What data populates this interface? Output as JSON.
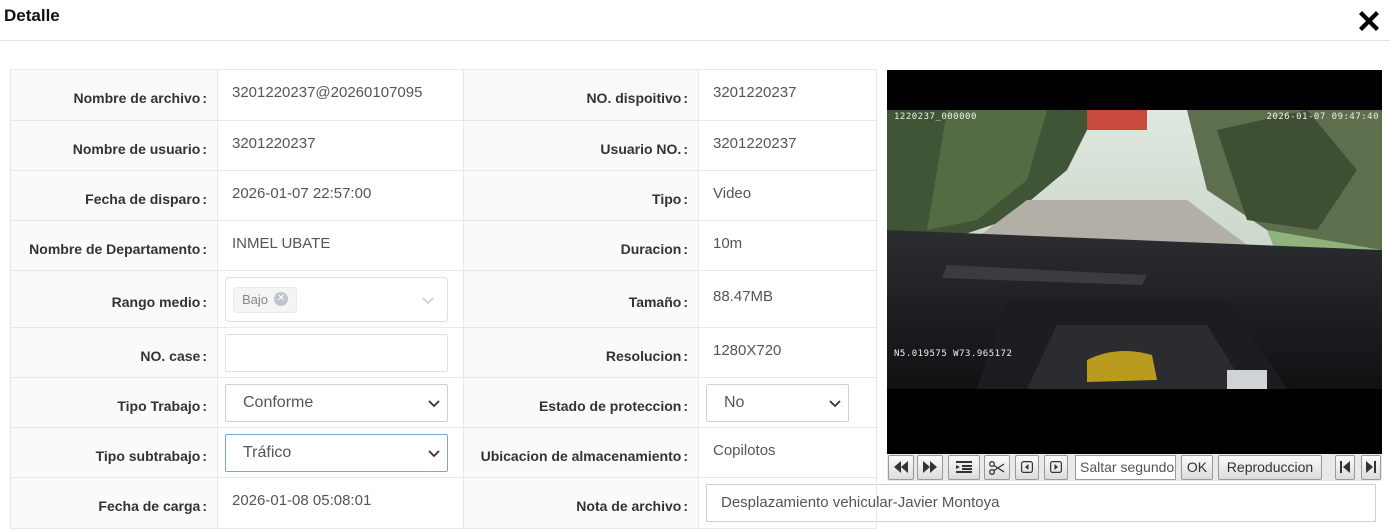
{
  "dialog": {
    "title": "Detalle",
    "close_icon": "close-x-icon"
  },
  "left": {
    "file_name_label": "Nombre de archivo",
    "file_name_value": "3201220237@20260107095",
    "user_name_label": "Nombre de usuario",
    "user_name_value": "3201220237",
    "trigger_date_label": "Fecha de disparo",
    "trigger_date_value": "2026-01-07 22:57:00",
    "department_label": "Nombre de Departamento",
    "department_value": "INMEL UBATE",
    "range_label": "Rango medio",
    "range_tag": "Bajo",
    "case_label": "NO. case",
    "case_value": "",
    "work_type_label": "Tipo Trabajo",
    "work_type_value": "Conforme",
    "subwork_type_label": "Tipo subtrabajo",
    "subwork_type_value": "Tráfico",
    "upload_date_label": "Fecha de carga",
    "upload_date_value": "2026-01-08 05:08:01"
  },
  "right": {
    "device_label": "NO. dispoitivo",
    "device_value": "3201220237",
    "user_no_label": "Usuario NO.",
    "user_no_value": "3201220237",
    "type_label": "Tipo",
    "type_value": "Video",
    "duration_label": "Duracion",
    "duration_value": "10m",
    "size_label": "Tamaño",
    "size_value": "88.47MB",
    "resolution_label": "Resolucion",
    "resolution_value": "1280X720",
    "protection_label": "Estado de proteccion",
    "protection_value": "No",
    "storage_label": "Ubicacion de almacenamiento",
    "storage_value": "Copilotos",
    "note_label": "Nota de archivo",
    "note_value": "Desplazamiento vehicular-Javier Montoya"
  },
  "video": {
    "osd_top_left": "1220237_000000",
    "osd_top_right": "2026-01-07 09:47:40",
    "osd_gps": "N5.019575 W73.965172",
    "seek_placeholder": "Saltar segundos",
    "ok_label": "OK",
    "play_label": "Reproduccion"
  },
  "colors": {
    "label_bg": "#fafafa",
    "border": "#e8e8e8",
    "focus_border": "#7aa7d9"
  }
}
